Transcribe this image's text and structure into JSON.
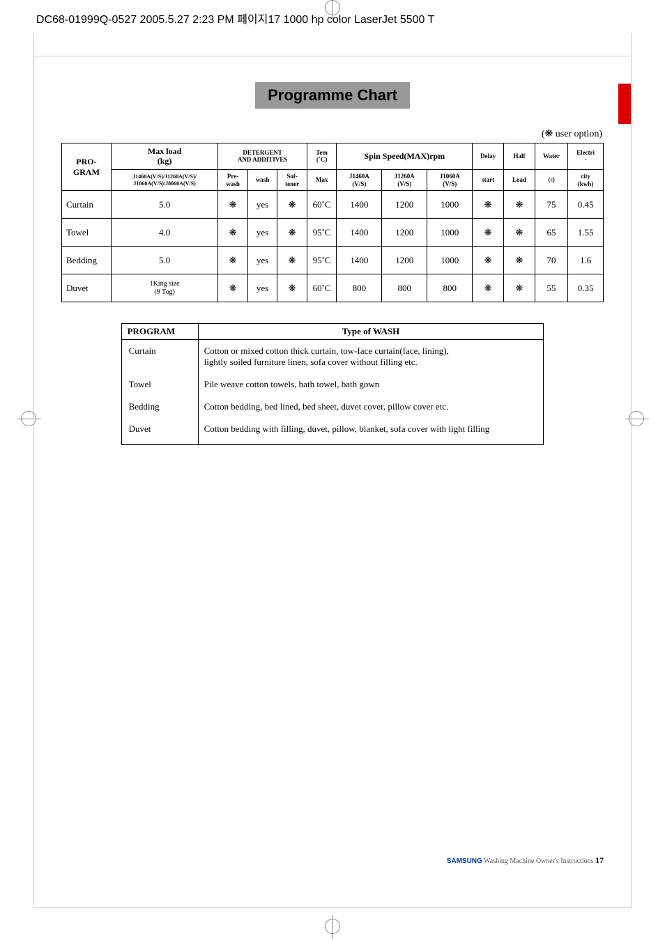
{
  "print_header": "DC68-01999Q-0527  2005.5.27 2:23 PM  페이지17   1000 hp color LaserJet 5500  T",
  "section_title": "Programme Chart",
  "user_option_note": "(❋ user option)",
  "headers": {
    "program": "PRO-\nGRAM",
    "maxload": "Max load\n(kg)",
    "maxload_sub": "J1460A(V/S)/J1260A(V/S)/\nJ1060A(V/S)/J8060A(V/S)",
    "detergent": "DETERGENT\nAND ADDITIVES",
    "prewash": "Pre-\nwash",
    "wash": "wash",
    "softener": "Sof-\ntener",
    "temp": "Tem\n(˚C)",
    "temp_sub": "Max",
    "spin": "Spin Speed(MAX)rpm",
    "spin_a": "J1460A\n(V/S)",
    "spin_b": "J1260A\n(V/S)",
    "spin_c": "J1060A\n(V/S)",
    "delay": "Delay",
    "delay_sub": "start",
    "half": "Half",
    "half_sub": "Load",
    "water": "Water",
    "water_sub": "(ℓ)",
    "elec": "Electri\n-",
    "elec_sub": "city\n(kwh)"
  },
  "rows": [
    {
      "program": "Curtain",
      "maxload": "5.0",
      "prewash": "❋",
      "wash": "yes",
      "softener": "❋",
      "temp": "60˚C",
      "spin_a": "1400",
      "spin_b": "1200",
      "spin_c": "1000",
      "delay": "❋",
      "half": "❋",
      "water": "75",
      "elec": "0.45"
    },
    {
      "program": "Towel",
      "maxload": "4.0",
      "prewash": "❋",
      "wash": "yes",
      "softener": "❋",
      "temp": "95˚C",
      "spin_a": "1400",
      "spin_b": "1200",
      "spin_c": "1000",
      "delay": "❋",
      "half": "❋",
      "water": "65",
      "elec": "1.55"
    },
    {
      "program": "Bedding",
      "maxload": "5.0",
      "prewash": "❋",
      "wash": "yes",
      "softener": "❋",
      "temp": "95˚C",
      "spin_a": "1400",
      "spin_b": "1200",
      "spin_c": "1000",
      "delay": "❋",
      "half": "❋",
      "water": "70",
      "elec": "1.6"
    },
    {
      "program": "Duvet",
      "maxload": "1King size\n(9 Tog)",
      "prewash": "❋",
      "wash": "yes",
      "softener": "❋",
      "temp": "60˚C",
      "spin_a": "800",
      "spin_b": "800",
      "spin_c": "800",
      "delay": "❋",
      "half": "❋",
      "water": "55",
      "elec": "0.35"
    }
  ],
  "wash_headers": {
    "program": "PROGRAM",
    "type": "Type of  WASH"
  },
  "wash_rows": [
    {
      "program": "Curtain",
      "desc": "Cotton or mixed cotton thick curtain, tow-face curtain(face, lining),\nlightly soiled furniture linen, sofa cover without filling etc."
    },
    {
      "program": "Towel",
      "desc": "Pile weave cotton towels, bath towel, bath gown"
    },
    {
      "program": "Bedding",
      "desc": "Cotton bedding, bed lined, bed sheet, duvet cover, pillow cover etc."
    },
    {
      "program": "Duvet",
      "desc": "Cotton bedding with filling, duvet, pillow, blanket, sofa cover with light filling"
    }
  ],
  "footer": {
    "brand": "SAMSUNG",
    "text": "  Washing Machine Owner's Instructions  ",
    "page": "17"
  }
}
